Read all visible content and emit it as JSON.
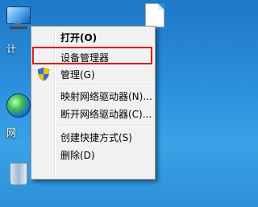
{
  "desktop": {
    "computer_label": "计",
    "network_label": "网"
  },
  "menu": {
    "items": [
      {
        "label": "打开(O)"
      },
      {
        "label": "设备管理器"
      },
      {
        "label": "管理(G)"
      },
      {
        "label": "映射网络驱动器(N)..."
      },
      {
        "label": "断开网络驱动器(C)..."
      },
      {
        "label": "创建快捷方式(S)"
      },
      {
        "label": "删除(D)"
      }
    ],
    "highlight_color": "#d32020"
  },
  "icons": {
    "computer": "computer-icon",
    "network": "network-icon",
    "recycle": "recycle-bin-icon",
    "document": "document-icon",
    "shield": "uac-shield-icon"
  }
}
